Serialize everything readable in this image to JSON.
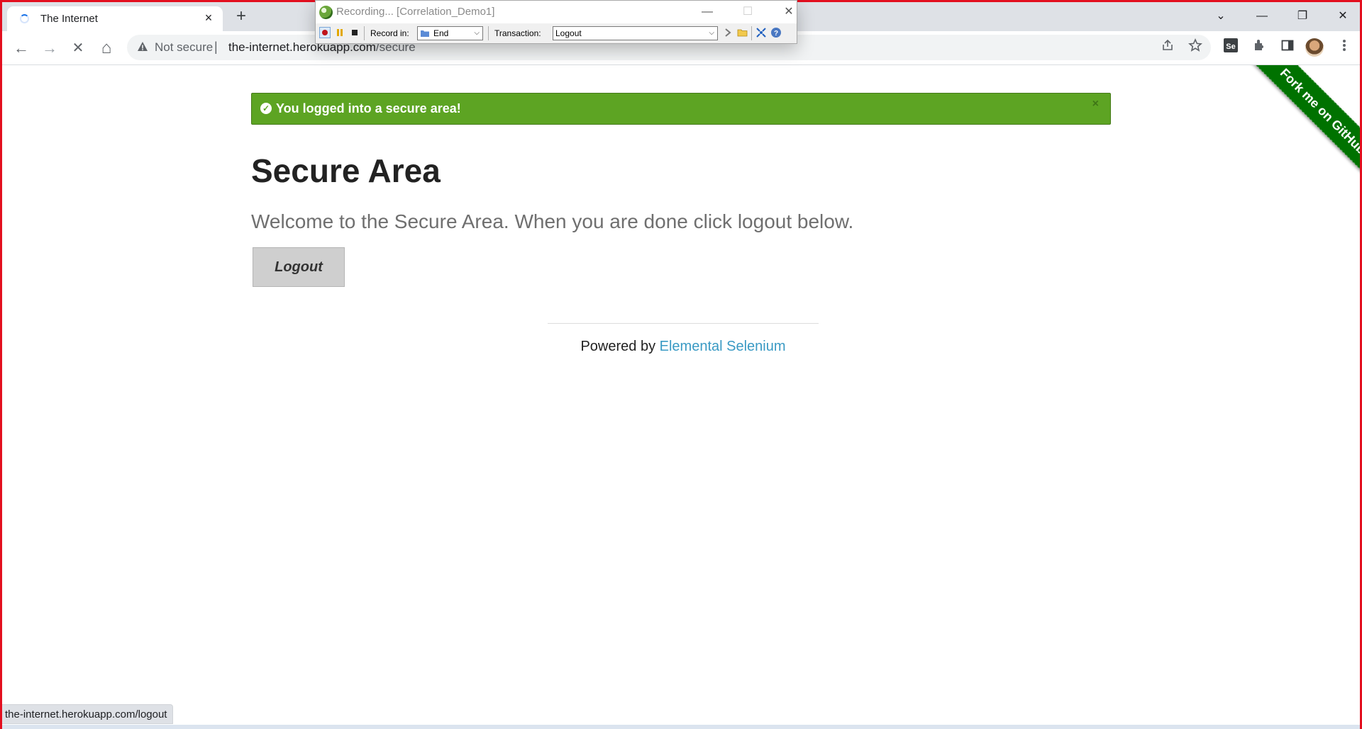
{
  "browser": {
    "tab_title": "The Internet",
    "tab_close": "×",
    "new_tab": "+",
    "window_controls": {
      "tab_search": "⌄",
      "minimize": "—",
      "restore": "❐",
      "close": "✕"
    },
    "nav": {
      "back": "←",
      "forward": "→",
      "stop": "✕",
      "home": "⌂"
    },
    "security_label": "Not secure",
    "separator": "|",
    "url_host": "the-internet.herokuapp.com",
    "url_path": "/secure",
    "toolbar_icons": [
      "share-icon",
      "star-icon",
      "selenium-ide-icon",
      "extensions-icon",
      "side-panel-icon",
      "profile-avatar",
      "more-icon"
    ]
  },
  "recorder": {
    "title": "Recording... [Correlation_Demo1]",
    "record_in_label": "Record in:",
    "record_in_value": "End",
    "transaction_label": "Transaction:",
    "transaction_value": "Logout"
  },
  "page": {
    "flash_message": "You logged into a secure area!",
    "flash_close": "×",
    "heading": "Secure Area",
    "subheading": "Welcome to the Secure Area. When you are done click logout below.",
    "logout_button": "Logout",
    "footer_prefix": "Powered by ",
    "footer_link": "Elemental Selenium",
    "ribbon": "Fork me on GitHub"
  },
  "status_bar": "the-internet.herokuapp.com/logout",
  "colors": {
    "flash_bg": "#5da423",
    "link": "#3a9ac4",
    "ribbon": "#007200",
    "frame_border": "#e30f1f"
  }
}
